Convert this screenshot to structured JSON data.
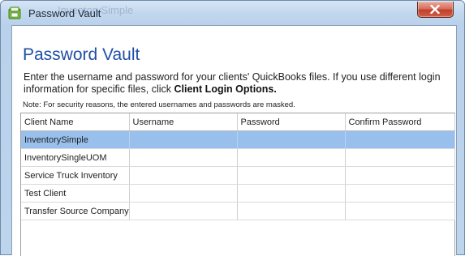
{
  "window": {
    "title": "Password Vault",
    "background_title": "InventorySimple",
    "close_icon": "close-icon"
  },
  "page": {
    "heading": "Password Vault",
    "instructions_prefix": "Enter the username and password for your clients' QuickBooks files. If you use different login information for specific files, click ",
    "instructions_link": "Client Login Options.",
    "note": "Note: For security reasons, the entered usernames and passwords are masked."
  },
  "grid": {
    "columns": [
      "Client Name",
      "Username",
      "Password",
      "Confirm Password"
    ],
    "rows": [
      {
        "client": "InventorySimple",
        "username": "",
        "password": "",
        "confirm": "",
        "selected": true
      },
      {
        "client": "InventorySingleUOM",
        "username": "",
        "password": "",
        "confirm": "",
        "selected": false
      },
      {
        "client": "Service Truck Inventory",
        "username": "",
        "password": "",
        "confirm": "",
        "selected": false
      },
      {
        "client": "Test Client",
        "username": "",
        "password": "",
        "confirm": "",
        "selected": false
      },
      {
        "client": "Transfer Source Company",
        "username": "",
        "password": "",
        "confirm": "",
        "selected": false
      }
    ]
  },
  "colors": {
    "heading": "#1f4fa6",
    "selection": "#99c0ec",
    "close_button": "#c13f2a"
  }
}
